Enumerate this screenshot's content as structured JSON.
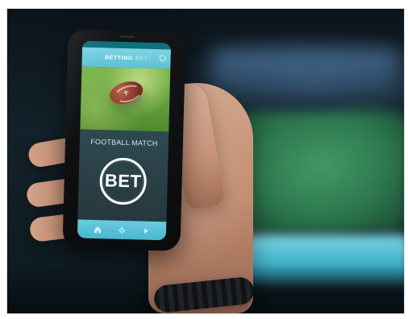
{
  "phone_app": {
    "header_left": "BETTING",
    "header_right": "BET",
    "match_label": "FOOTBALL MATCH",
    "primary_action": "BET"
  },
  "icons": {
    "header": "settings-icon",
    "hero": "football-icon",
    "nav": [
      "home-icon",
      "settings-icon",
      "play-icon"
    ]
  },
  "colors": {
    "app_accent": "#5dc1d4",
    "app_dark": "#2a3f46",
    "bet_ring": "#ffffff"
  }
}
